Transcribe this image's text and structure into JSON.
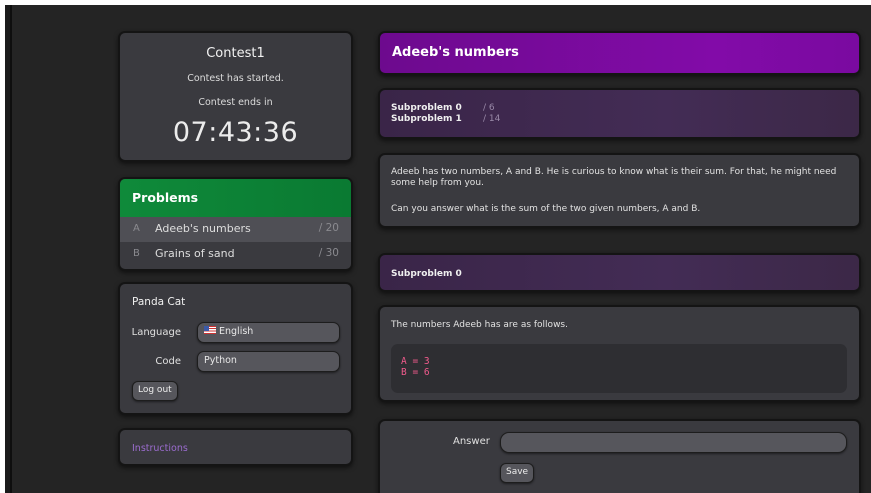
{
  "contest": {
    "title": "Contest1",
    "status": "Contest has started.",
    "ends_label": "Contest ends in",
    "timer": "07:43:36"
  },
  "problems": {
    "header": "Problems",
    "items": [
      {
        "letter": "A",
        "name": "Adeeb's numbers",
        "score": "/ 20",
        "active": true
      },
      {
        "letter": "B",
        "name": "Grains of sand",
        "score": "/ 30",
        "active": false
      }
    ]
  },
  "user": {
    "name": "Panda Cat",
    "language_label": "Language",
    "language_value": "English",
    "code_label": "Code",
    "code_value": "Python",
    "logout_label": "Log out"
  },
  "instructions": {
    "label": "Instructions"
  },
  "problem": {
    "title": "Adeeb's numbers",
    "subproblems": [
      {
        "name": "Subproblem 0",
        "score": "/  6"
      },
      {
        "name": "Subproblem 1",
        "score": "/ 14"
      }
    ],
    "statement_p1": "Adeeb has two numbers, A and B. He is curious to know what is their sum. For that, he might need some help from you.",
    "statement_p2": "Can you answer what is the sum of the two given numbers, A and B."
  },
  "subproblem0": {
    "header": "Subproblem 0",
    "intro": "The numbers Adeeb has are as follows.",
    "code_lines": [
      "A = 3",
      "B = 6"
    ],
    "answer_label": "Answer",
    "save_label": "Save"
  },
  "colors": {
    "background": "#242424",
    "card": "#3a3a3f",
    "problems_header": "#0f8a3a",
    "title_bar": "#820ba8",
    "code_text": "#f25b8d",
    "link": "#9b6ccf"
  }
}
